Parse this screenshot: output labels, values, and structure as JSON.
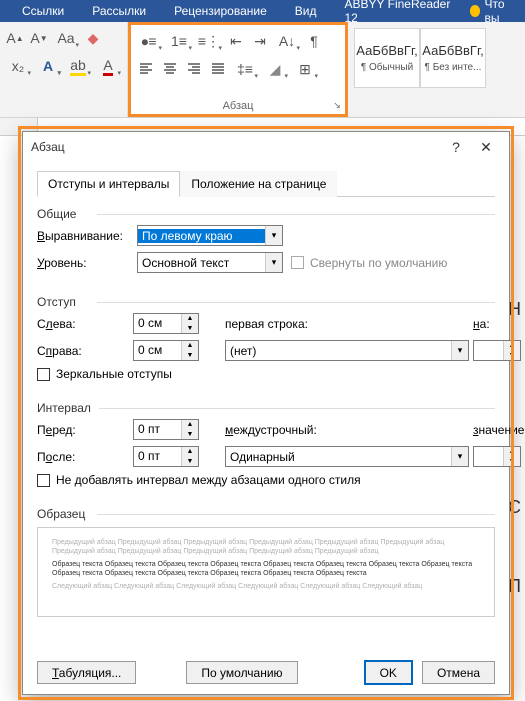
{
  "ribbon": {
    "tabs": [
      "Ссылки",
      "Рассылки",
      "Рецензирование",
      "Вид",
      "ABBYY FineReader 12"
    ],
    "tell_me": "Что вы",
    "paragraph_group_label": "Абзац",
    "styles": [
      {
        "sample": "АаБбВвГг,",
        "name": "¶ Обычный"
      },
      {
        "sample": "АаБбВвГг,",
        "name": "¶ Без инте..."
      }
    ]
  },
  "dialog": {
    "title": "Абзац",
    "tabs": {
      "indents": "Отступы и интервалы",
      "position": "Положение на странице"
    },
    "section_general": "Общие",
    "alignment_label": "Выравнивание:",
    "alignment_value": "По левому краю",
    "level_label": "Уровень:",
    "level_value": "Основной текст",
    "collapsed_label": "Свернуты по умолчанию",
    "section_indent": "Отступ",
    "left_label": "Слева:",
    "left_value": "0 см",
    "right_label": "Справа:",
    "right_value": "0 см",
    "first_line_label": "первая строка:",
    "first_line_value": "(нет)",
    "by_label": "на:",
    "by_value": "",
    "mirror_label": "Зеркальные отступы",
    "section_spacing": "Интервал",
    "before_label": "Перед:",
    "before_value": "0 пт",
    "after_label": "После:",
    "after_value": "0 пт",
    "line_spacing_label": "междустрочный:",
    "line_spacing_value": "Одинарный",
    "at_label": "значение:",
    "at_value": "",
    "no_space_label": "Не добавлять интервал между абзацами одного стиля",
    "section_preview": "Образец",
    "preview_prev": "Предыдущий абзац Предыдущий абзац Предыдущий абзац Предыдущий абзац Предыдущий абзац Предыдущий абзац Предыдущий абзац Предыдущий абзац Предыдущий абзац Предыдущий абзац Предыдущий абзац",
    "preview_sample": "Образец текста Образец текста Образец текста Образец текста Образец текста Образец текста Образец текста Образец текста Образец текста Образец текста Образец текста Образец текста Образец текста Образец текста",
    "preview_next": "Следующий абзац Следующий абзац Следующий абзац Следующий абзац Следующий абзац Следующий абзац",
    "btn_tabs": "Табуляция...",
    "btn_default": "По умолчанию",
    "btn_ok": "OK",
    "btn_cancel": "Отмена"
  }
}
